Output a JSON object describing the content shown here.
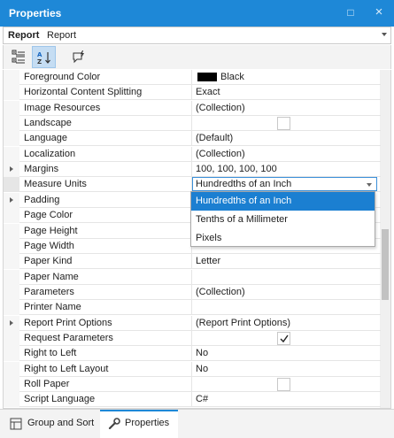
{
  "window": {
    "title": "Properties",
    "restore_glyph": "□",
    "close_glyph": "×"
  },
  "object_selector": {
    "type_label": "Report",
    "name_label": "Report"
  },
  "toolbar": {
    "buttons": [
      {
        "name": "categorized-view",
        "icon": "categorized-icon",
        "active": false
      },
      {
        "name": "alphabetical-view",
        "icon": "sort-az-icon",
        "active": true
      },
      {
        "name": "events-view",
        "icon": "events-icon",
        "active": false
      }
    ]
  },
  "properties": [
    {
      "name": "Foreground Color",
      "value": "Black",
      "kind": "color",
      "color": "#000000"
    },
    {
      "name": "Horizontal Content Splitting",
      "value": "Exact"
    },
    {
      "name": "Image Resources",
      "value": "(Collection)"
    },
    {
      "name": "Landscape",
      "value": "",
      "kind": "checkbox",
      "checked": false
    },
    {
      "name": "Language",
      "value": "(Default)"
    },
    {
      "name": "Localization",
      "value": "(Collection)"
    },
    {
      "name": "Margins",
      "value": "100, 100, 100, 100",
      "expandable": true
    },
    {
      "name": "Measure Units",
      "value": "Hundredths of an Inch",
      "kind": "editor",
      "selected": true
    },
    {
      "name": "Padding",
      "value": "",
      "expandable": true
    },
    {
      "name": "Page Color",
      "value": ""
    },
    {
      "name": "Page Height",
      "value": ""
    },
    {
      "name": "Page Width",
      "value": ""
    },
    {
      "name": "Paper Kind",
      "value": "Letter"
    },
    {
      "name": "Paper Name",
      "value": ""
    },
    {
      "name": "Parameters",
      "value": "(Collection)"
    },
    {
      "name": "Printer Name",
      "value": ""
    },
    {
      "name": "Report Print Options",
      "value": "(Report Print Options)",
      "expandable": true
    },
    {
      "name": "Request Parameters",
      "value": "",
      "kind": "checkbox",
      "checked": true
    },
    {
      "name": "Right to Left",
      "value": "No"
    },
    {
      "name": "Right to Left Layout",
      "value": "No"
    },
    {
      "name": "Roll Paper",
      "value": "",
      "kind": "checkbox",
      "checked": false
    },
    {
      "name": "Script Language",
      "value": "C#"
    }
  ],
  "dropdown": {
    "options": [
      "Hundredths of an Inch",
      "Tenths of a Millimeter",
      "Pixels"
    ],
    "selected_index": 0
  },
  "bottom_tabs": [
    {
      "label": "Group and Sort",
      "icon": "group-sort-icon",
      "active": false
    },
    {
      "label": "Properties",
      "icon": "wrench-icon",
      "active": true
    }
  ],
  "colors": {
    "accent": "#1e88d7",
    "selection": "#1b7fd1"
  }
}
